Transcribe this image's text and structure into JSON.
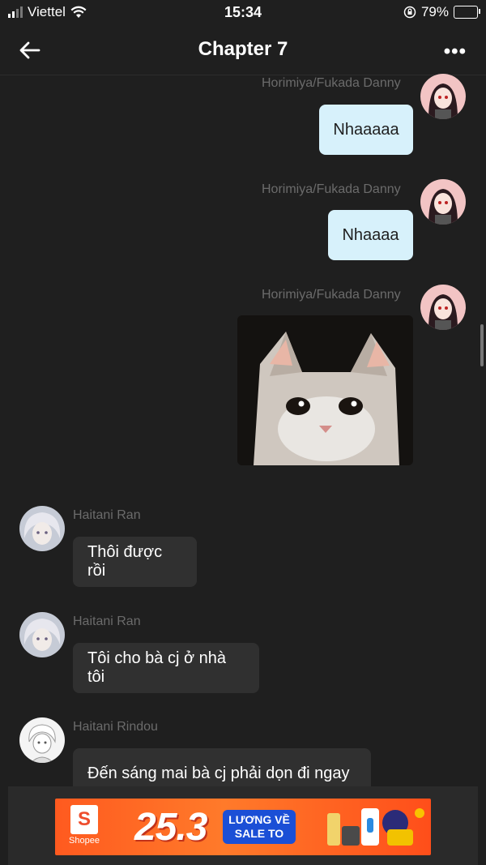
{
  "status_bar": {
    "carrier": "Viettel",
    "time": "15:34",
    "battery": "79%",
    "battery_level": 0.79
  },
  "header": {
    "title": "Chapter 7"
  },
  "messages": [
    {
      "sender": "Horimiya/Fukada Danny",
      "text": "Nhaaaaa",
      "direction": "out"
    },
    {
      "sender": "Horimiya/Fukada Danny",
      "text": "Nhaaaa",
      "direction": "out"
    },
    {
      "sender": "Horimiya/Fukada Danny",
      "image": "crying-cat-meme",
      "direction": "out"
    },
    {
      "sender": "Haitani Ran",
      "text": "Thôi được rồi",
      "direction": "in"
    },
    {
      "sender": "Haitani Ran",
      "text": "Tôi cho bà cj ở nhà tôi",
      "direction": "in"
    },
    {
      "sender": "Haitani Rindou",
      "text": "Đến sáng mai bà cj phải dọn đi ngay",
      "direction": "in"
    }
  ],
  "ad": {
    "brand": "Shopee",
    "date": "25.3",
    "tag_line1": "LƯƠNG VỀ",
    "tag_line2": "SALE TO"
  },
  "colors": {
    "background": "#1f1f1f",
    "outgoing_bubble": "#d7f1fb",
    "incoming_bubble": "#303030",
    "accent": "#ee4d2d"
  }
}
